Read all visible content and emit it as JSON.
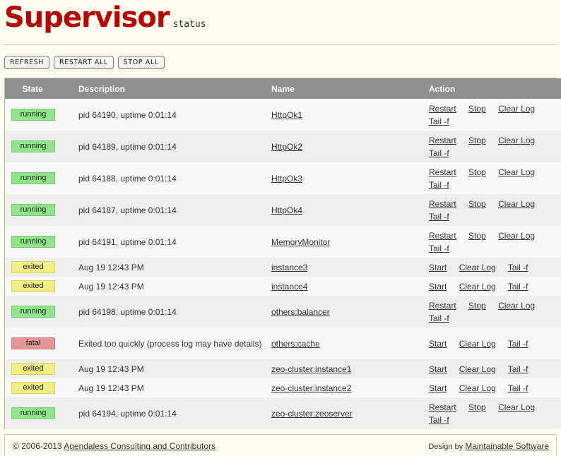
{
  "header": {
    "logo": "Supervisor",
    "subtitle": "status"
  },
  "buttons": {
    "refresh": "REFRESH",
    "restart_all": "RESTART ALL",
    "stop_all": "STOP ALL"
  },
  "table": {
    "headers": {
      "state": "State",
      "description": "Description",
      "name": "Name",
      "action": "Action"
    },
    "rows": [
      {
        "state": "running",
        "desc": "pid 64190, uptime 0:01:14",
        "name": "HttpOk1",
        "actions": [
          "Restart",
          "Stop",
          "Clear Log",
          "Tail -f"
        ]
      },
      {
        "state": "running",
        "desc": "pid 64189, uptime 0:01:14",
        "name": "HttpOk2",
        "actions": [
          "Restart",
          "Stop",
          "Clear Log",
          "Tail -f"
        ]
      },
      {
        "state": "running",
        "desc": "pid 64188, uptime 0:01:14",
        "name": "HttpOk3",
        "actions": [
          "Restart",
          "Stop",
          "Clear Log",
          "Tail -f"
        ]
      },
      {
        "state": "running",
        "desc": "pid 64187, uptime 0:01:14",
        "name": "HttpOk4",
        "actions": [
          "Restart",
          "Stop",
          "Clear Log",
          "Tail -f"
        ]
      },
      {
        "state": "running",
        "desc": "pid 64191, uptime 0:01:14",
        "name": "MemoryMonitor",
        "actions": [
          "Restart",
          "Stop",
          "Clear Log",
          "Tail -f"
        ]
      },
      {
        "state": "exited",
        "desc": "Aug 19 12:43 PM",
        "name": "instance3",
        "actions": [
          "Start",
          "Clear Log",
          "Tail -f"
        ]
      },
      {
        "state": "exited",
        "desc": "Aug 19 12:43 PM",
        "name": "instance4",
        "actions": [
          "Start",
          "Clear Log",
          "Tail -f"
        ]
      },
      {
        "state": "running",
        "desc": "pid 64198, uptime 0:01:14",
        "name": "others:balancer",
        "actions": [
          "Restart",
          "Stop",
          "Clear Log",
          "Tail -f"
        ]
      },
      {
        "state": "fatal",
        "desc": "Exited too quickly (process log may have details)",
        "name": "others:cache",
        "actions": [
          "Start",
          "Clear Log",
          "Tail -f"
        ]
      },
      {
        "state": "exited",
        "desc": "Aug 19 12:43 PM",
        "name": "zeo-cluster:instance1",
        "actions": [
          "Start",
          "Clear Log",
          "Tail -f"
        ]
      },
      {
        "state": "exited",
        "desc": "Aug 19 12:43 PM",
        "name": "zeo-cluster:instance2",
        "actions": [
          "Start",
          "Clear Log",
          "Tail -f"
        ]
      },
      {
        "state": "running",
        "desc": "pid 64194, uptime 0:01:14",
        "name": "zeo-cluster:zeoserver",
        "actions": [
          "Restart",
          "Stop",
          "Clear Log",
          "Tail -f"
        ]
      }
    ]
  },
  "footer": {
    "copyright_prefix": "© 2006-2013",
    "copyright_link": "Agendaless Consulting and Contributors",
    "design_prefix": "Design by",
    "design_link": "Maintainable Software"
  },
  "colors": {
    "logo": "#b80000",
    "header_bg": "#8f8f8f",
    "running": "#8fe589",
    "exited": "#f1ef84",
    "fatal": "#e49595",
    "page_bg": "#fffdef"
  }
}
